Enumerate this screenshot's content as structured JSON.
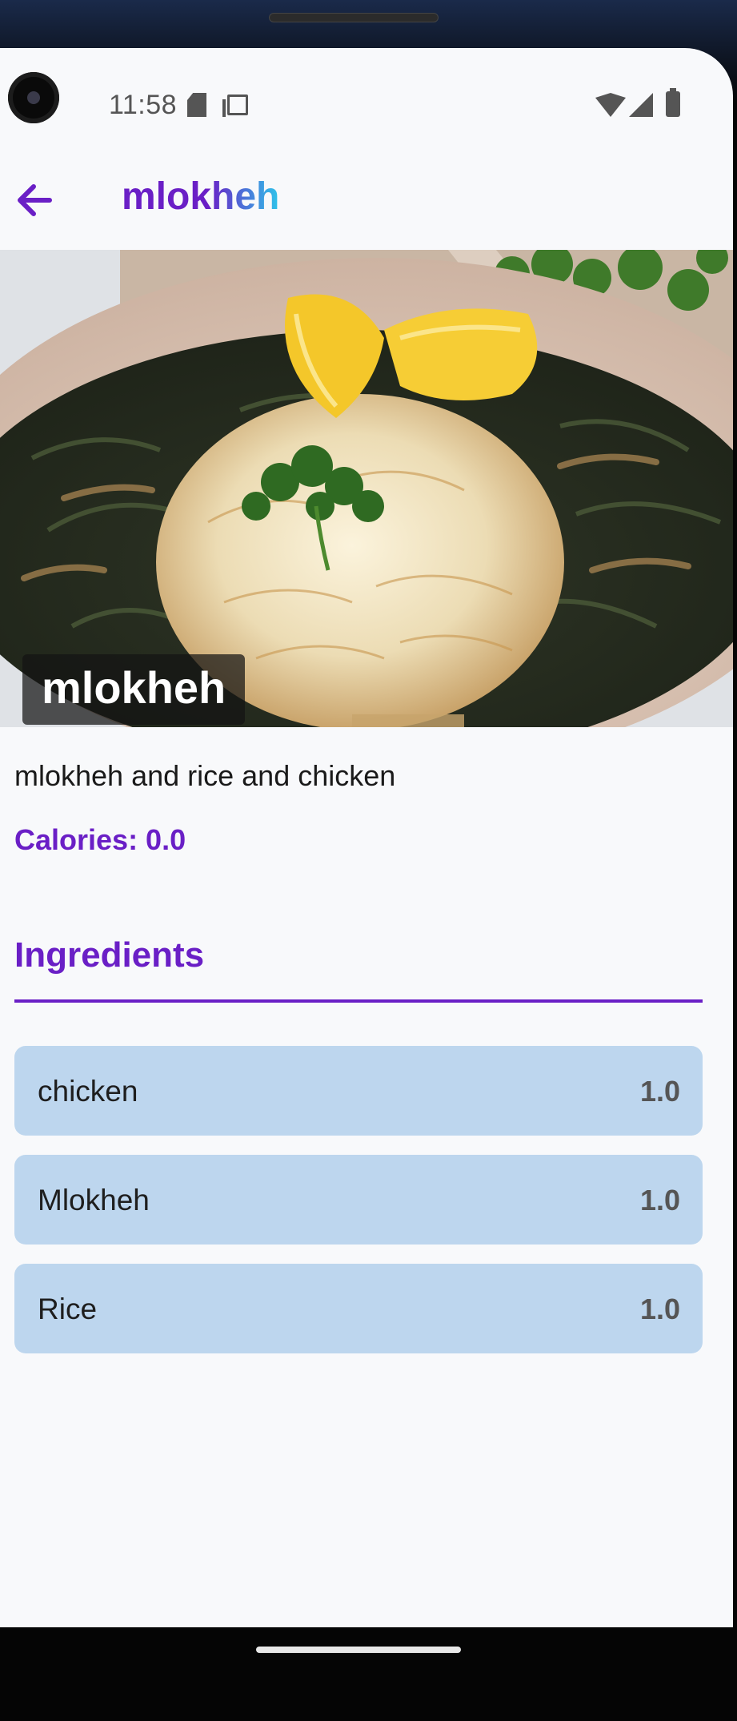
{
  "status_bar": {
    "time": "11:58",
    "icons": [
      "sd-card-icon",
      "copy-icon",
      "wifi-icon",
      "signal-icon",
      "battery-icon"
    ]
  },
  "app_bar": {
    "back_icon": "arrow-left-icon",
    "title": "mlokheh"
  },
  "hero": {
    "title": "mlokheh"
  },
  "recipe": {
    "description": "mlokheh and rice and chicken",
    "calories_label": "Calories: 0.0"
  },
  "ingredients": {
    "heading": "Ingredients",
    "items": [
      {
        "name": "chicken",
        "qty": "1.0"
      },
      {
        "name": "Mlokheh",
        "qty": "1.0"
      },
      {
        "name": "Rice",
        "qty": "1.0"
      }
    ]
  },
  "colors": {
    "accent": "#6a1fc6",
    "gradient_end": "#2fc4ea",
    "ingredient_row": "#bdd6ee",
    "background": "#f8f9fb"
  }
}
